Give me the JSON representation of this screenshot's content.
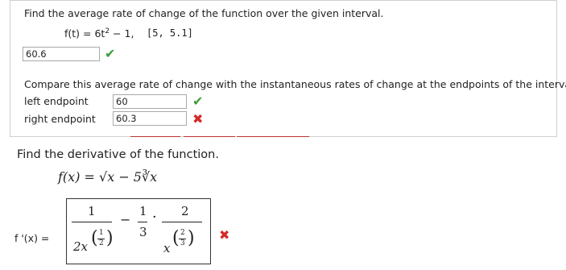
{
  "q1": {
    "prompt": "Find the average rate of change of the function over the given interval.",
    "func_lhs": "f(t) = 6t",
    "func_exp": "2",
    "func_rest": " − 1,",
    "interval": "[5, 5.1]",
    "answer": "60.6",
    "status": "correct"
  },
  "q2": {
    "prompt": "Compare this average rate of change with the instantaneous rates of change at the endpoints of the interval",
    "left_label": "left endpoint",
    "left_value": "60",
    "left_status": "correct",
    "right_label": "right endpoint",
    "right_value": "60.3",
    "right_status": "incorrect"
  },
  "q3": {
    "prompt": "Find the derivative of the function.",
    "function": "f(x) = √x − 5∛x",
    "answer_label": "f '(x) =",
    "term1_num": "1",
    "term1_den_base": "2x",
    "term1_exp_num": "1",
    "term1_exp_den": "2",
    "minus": "−",
    "term2_coef_num": "1",
    "term2_coef_den": "3",
    "dot": "·",
    "term2_num": "2",
    "term2_den_base": "x",
    "term2_exp_num": "2",
    "term2_exp_den": "3",
    "status": "incorrect"
  },
  "icons": {
    "check": "✔",
    "cross": "✖"
  },
  "colors": {
    "correct": "#3d9c3d",
    "incorrect": "#d42a2a"
  }
}
